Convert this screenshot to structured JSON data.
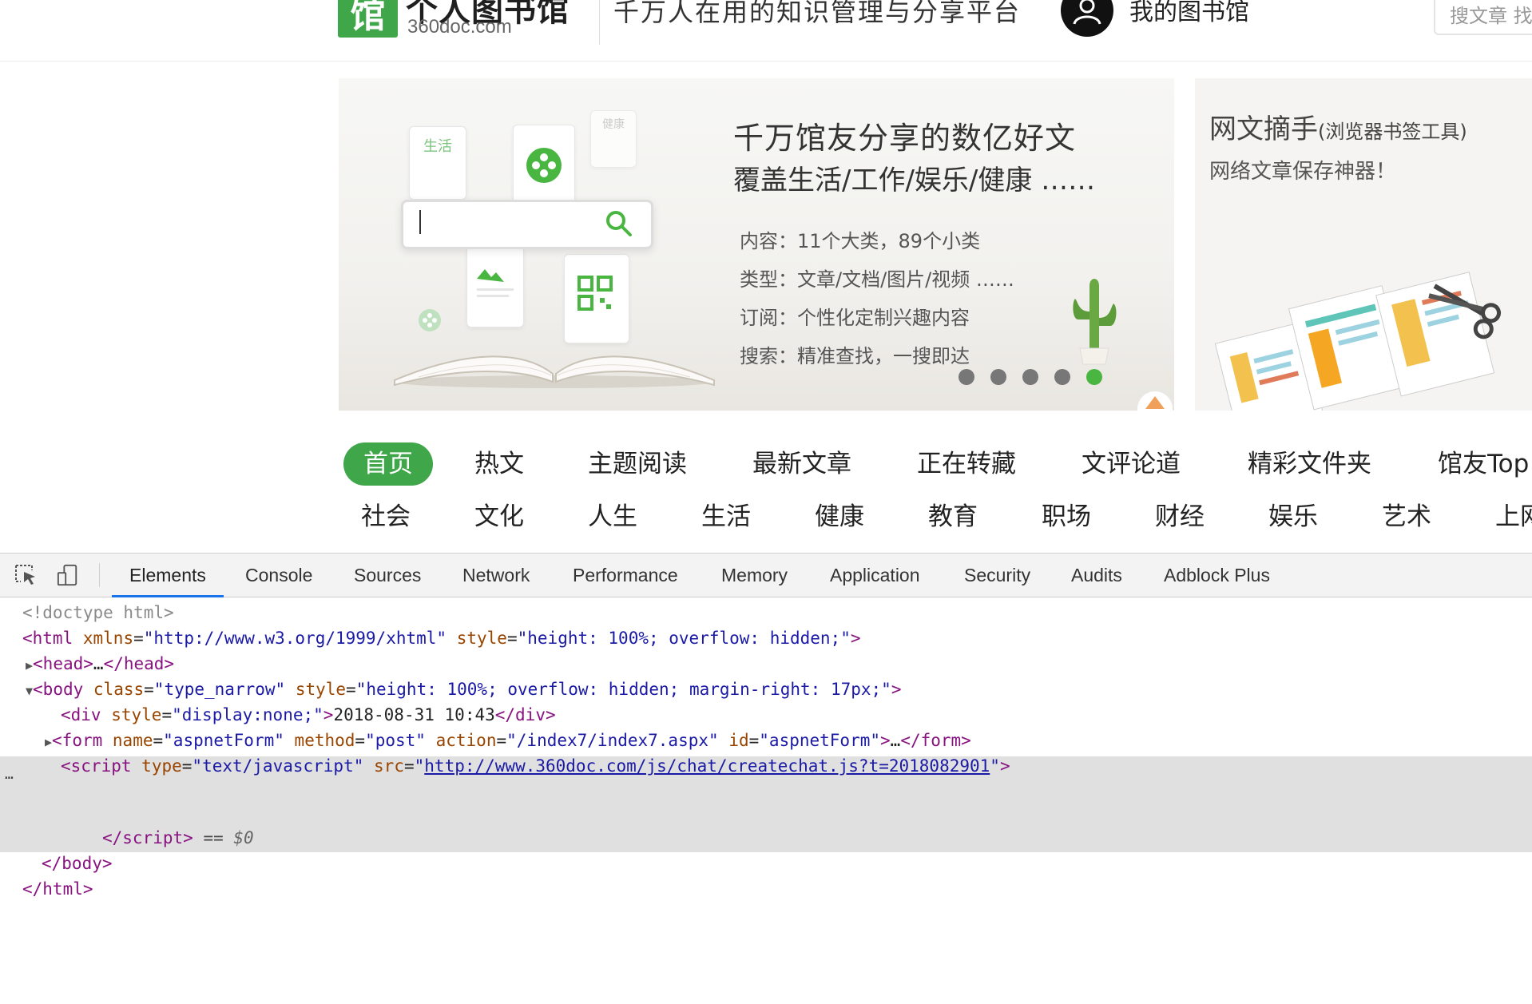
{
  "header": {
    "logo_mark": "馆",
    "logo_title": "个人图书馆",
    "logo_domain": "360doc.com",
    "slogan": "千万人在用的知识管理与分享平台",
    "my_library": "我的图书馆",
    "search_placeholder": "搜文章 找"
  },
  "banner": {
    "headline1": "千万馆友分享的数亿好文",
    "headline2": "覆盖生活/工作/娱乐/健康 ……",
    "lines": [
      "内容：11个大类，89个小类",
      "类型：文章/文档/图片/视频 ……",
      "订阅：个性化定制兴趣内容",
      "搜索：精准查找，一搜即达"
    ],
    "card_labels": [
      "生活",
      "健康"
    ],
    "slide_count": 5,
    "active_slide": 5,
    "side_title": "网文摘手",
    "side_title_small": "(浏览器书签工具)",
    "side_subtitle": "网络文章保存神器！"
  },
  "nav": {
    "row1": [
      "首页",
      "热文",
      "主题阅读",
      "最新文章",
      "正在转藏",
      "文评论道",
      "精彩文件夹",
      "馆友Top"
    ],
    "row2": [
      "社会",
      "文化",
      "人生",
      "生活",
      "健康",
      "教育",
      "职场",
      "财经",
      "娱乐",
      "艺术",
      "上网"
    ],
    "active": "首页"
  },
  "devtools": {
    "tabs": [
      "Elements",
      "Console",
      "Sources",
      "Network",
      "Performance",
      "Memory",
      "Application",
      "Security",
      "Audits",
      "Adblock Plus"
    ],
    "active_tab": "Elements",
    "icons": [
      "inspect-element-icon",
      "device-toolbar-icon"
    ],
    "code": {
      "doctype": "<!doctype html>",
      "html_xmlns": "http://www.w3.org/1999/xhtml",
      "html_style": "height: 100%; overflow: hidden;",
      "head_collapsed": "…",
      "body_class": "type_narrow",
      "body_style": "height: 100%; overflow: hidden; margin-right: 17px;",
      "div_style": "display:none;",
      "div_text": "2018-08-31 10:43",
      "form_name": "aspnetForm",
      "form_method": "post",
      "form_action": "/index7/index7.aspx",
      "form_id": "aspnetForm",
      "form_collapsed": "…",
      "script_type": "text/javascript",
      "script_src": "http://www.360doc.com/js/chat/createchat.js?t=2018082901",
      "console_ref": "== $0",
      "gutter": "…"
    }
  },
  "colors": {
    "brand_green": "#3fa64a",
    "devtools_active": "#1a73e8",
    "tag": "#881280",
    "attr": "#994500",
    "value": "#1a1aa6"
  }
}
